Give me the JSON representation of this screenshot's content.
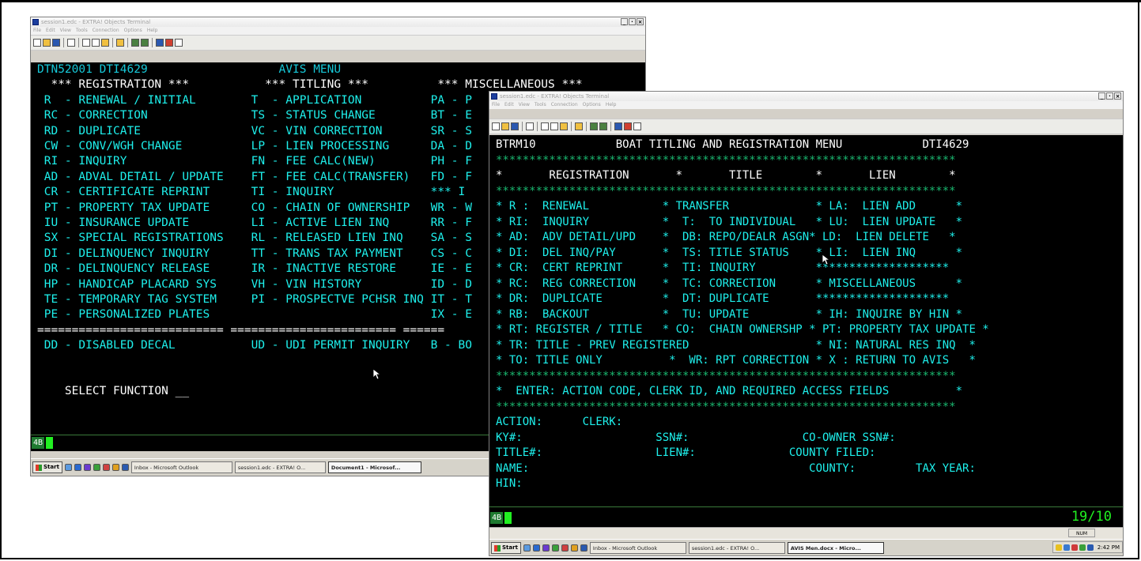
{
  "left_window": {
    "title": "session1.edc - EXTRA! Objects Terminal",
    "menu": [
      "File",
      "Edit",
      "View",
      "Tools",
      "Connection",
      "Options",
      "Help"
    ],
    "window_buttons": [
      "_",
      "·",
      "×"
    ],
    "screen_lines": [
      {
        "text": "DTN52001 DTI4629                   AVIS MENU",
        "color": "#16c8d8"
      },
      {
        "text": "  *** REGISTRATION ***           *** TITLING ***          *** MISCELLANEOUS ***",
        "color": "#ffffff"
      },
      {
        "text": " R  - RENEWAL / INITIAL        T  - APPLICATION          PA - P",
        "color": "#1ef0ec"
      },
      {
        "text": " RC - CORRECTION               TS - STATUS CHANGE        BT - E",
        "color": "#1ef0ec"
      },
      {
        "text": " RD - DUPLICATE                VC - VIN CORRECTION       SR - S",
        "color": "#1ef0ec"
      },
      {
        "text": " CW - CONV/WGH CHANGE          LP - LIEN PROCESSING      DA - D",
        "color": "#1ef0ec"
      },
      {
        "text": " RI - INQUIRY                  FN - FEE CALC(NEW)        PH - F",
        "color": "#1ef0ec"
      },
      {
        "text": " AD - ADVAL DETAIL / UPDATE    FT - FEE CALC(TRANSFER)   FD - F",
        "color": "#1ef0ec"
      },
      {
        "text": " CR - CERTIFICATE REPRINT      TI - INQUIRY              *** I",
        "color": "#1ef0ec"
      },
      {
        "text": " PT - PROPERTY TAX UPDATE      CO - CHAIN OF OWNERSHIP   WR - W",
        "color": "#1ef0ec"
      },
      {
        "text": " IU - INSURANCE UPDATE         LI - ACTIVE LIEN INQ      RR - F",
        "color": "#1ef0ec"
      },
      {
        "text": " SX - SPECIAL REGISTRATIONS    RL - RELEASED LIEN INQ    SA - S",
        "color": "#1ef0ec"
      },
      {
        "text": " DI - DELINQUENCY INQUIRY      TT - TRANS TAX PAYMENT    CS - C",
        "color": "#1ef0ec"
      },
      {
        "text": " DR - DELINQUENCY RELEASE      IR - INACTIVE RESTORE     IE - E",
        "color": "#1ef0ec"
      },
      {
        "text": " HP - HANDICAP PLACARD SYS     VH - VIN HISTORY          ID - D",
        "color": "#1ef0ec"
      },
      {
        "text": " TE - TEMPORARY TAG SYSTEM     PI - PROSPECTVE PCHSR INQ IT - T",
        "color": "#1ef0ec"
      },
      {
        "text": " PE - PERSONALIZED PLATES                                IX - E",
        "color": "#1ef0ec"
      },
      {
        "text": "=========================== ======================== ======",
        "color": "#ffffff"
      },
      {
        "text": " DD - DISABLED DECAL           UD - UDI PERMIT INQUIRY   B - BO",
        "color": "#1ef0ec"
      },
      {
        "text": "",
        "color": "#ffffff"
      },
      {
        "text": "",
        "color": "#ffffff"
      },
      {
        "text": "    SELECT FUNCTION __",
        "color": "#ffffff"
      }
    ],
    "indicator": "4B"
  },
  "left_taskbar": {
    "start": "Start",
    "buttons": [
      {
        "label": "Inbox - Microsoft Outlook",
        "active": false
      },
      {
        "label": "session1.edc - EXTRA! O...",
        "active": false
      },
      {
        "label": "Document1 - Microsof...",
        "active": true
      }
    ]
  },
  "right_window": {
    "title": "session1.edc - EXTRA! Objects Terminal",
    "menu": [
      "File",
      "Edit",
      "View",
      "Tools",
      "Connection",
      "Options",
      "Help"
    ],
    "window_buttons": [
      "_",
      "·",
      "×"
    ],
    "screen_lines": [
      {
        "text": "BTRM10            BOAT TITLING AND REGISTRATION MENU            DTI4629",
        "color": "#ffffff"
      },
      {
        "text": "*********************************************************************",
        "color": "#1ab870"
      },
      {
        "text": "*       REGISTRATION       *       TITLE        *       LIEN        *",
        "color": "#ffffff"
      },
      {
        "text": "*********************************************************************",
        "color": "#1ab870"
      },
      {
        "text": "* R :  RENEWAL           * TRANSFER             * LA:  LIEN ADD      *",
        "color": "#1ef0ec"
      },
      {
        "text": "* RI:  INQUIRY           *  T:  TO INDIVIDUAL   * LU:  LIEN UPDATE   *",
        "color": "#1ef0ec"
      },
      {
        "text": "* AD:  ADV DETAIL/UPD    *  DB: REPO/DEALR ASGN* LD:  LIEN DELETE   *",
        "color": "#1ef0ec"
      },
      {
        "text": "* DI:  DEL INQ/PAY       *  TS: TITLE STATUS    * LI:  LIEN INQ      *",
        "color": "#1ef0ec"
      },
      {
        "text": "* CR:  CERT REPRINT      *  TI: INQUIRY         ********************",
        "color": "#1ef0ec"
      },
      {
        "text": "* RC:  REG CORRECTION    *  TC: CORRECTION      * MISCELLANEOUS      *",
        "color": "#1ef0ec"
      },
      {
        "text": "* DR:  DUPLICATE         *  DT: DUPLICATE       ********************",
        "color": "#1ef0ec"
      },
      {
        "text": "* RB:  BACKOUT           *  TU: UPDATE          * IH: INQUIRE BY HIN *",
        "color": "#1ef0ec"
      },
      {
        "text": "* RT: REGISTER / TITLE   * CO:  CHAIN OWNERSHP * PT: PROPERTY TAX UPDATE *",
        "color": "#1ef0ec"
      },
      {
        "text": "* TR: TITLE - PREV REGISTERED                   * NI: NATURAL RES INQ  *",
        "color": "#1ef0ec"
      },
      {
        "text": "* TO: TITLE ONLY          *  WR: RPT CORRECTION * X : RETURN TO AVIS   *",
        "color": "#1ef0ec"
      },
      {
        "text": "*********************************************************************",
        "color": "#1ab870"
      },
      {
        "text": "*  ENTER: ACTION CODE, CLERK ID, AND REQUIRED ACCESS FIELDS          *",
        "color": "#1ef0ec"
      },
      {
        "text": "*********************************************************************",
        "color": "#1ab870"
      },
      {
        "text": "ACTION:      CLERK:",
        "color": "#1ef0ec"
      },
      {
        "text": "KY#:                    SSN#:                 CO-OWNER SSN#:",
        "color": "#1ef0ec"
      },
      {
        "text": "TITLE#:                 LIEN#:              COUNTY FILED:",
        "color": "#1ef0ec"
      },
      {
        "text": "NAME:                                          COUNTY:         TAX YEAR:",
        "color": "#1ef0ec"
      },
      {
        "text": "HIN:",
        "color": "#1ef0ec"
      }
    ],
    "indicator": "4B",
    "status_position": "19/10",
    "num_indicator": "NUM"
  },
  "right_taskbar": {
    "start": "Start",
    "buttons": [
      {
        "label": "Inbox - Microsoft Outlook",
        "active": false
      },
      {
        "label": "session1.edc - EXTRA! O...",
        "active": false
      },
      {
        "label": "AVIS Men.docx - Micro...",
        "active": true
      }
    ],
    "clock": "2:42 PM"
  }
}
